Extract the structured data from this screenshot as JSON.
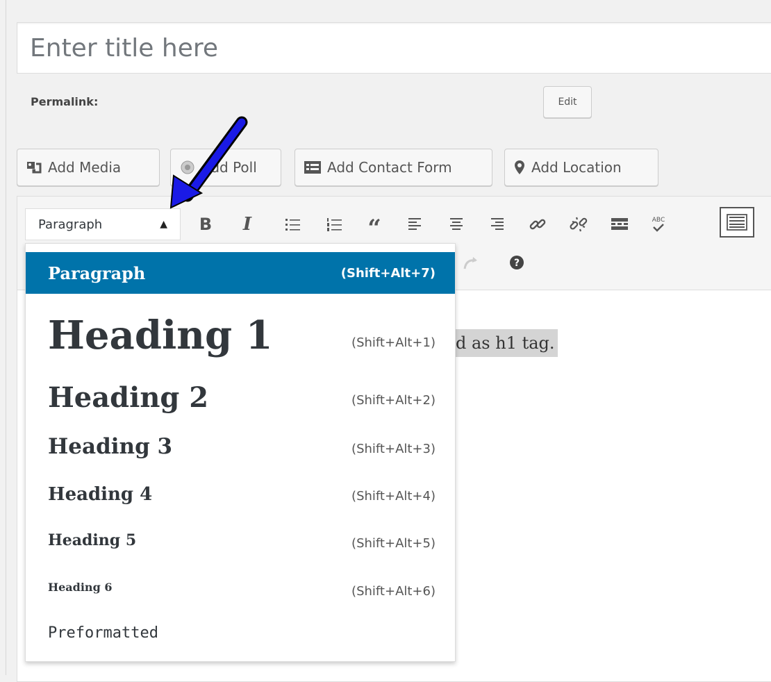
{
  "title_field": {
    "placeholder": "Enter title here"
  },
  "permalink": {
    "label": "Permalink:",
    "edit_label": "Edit"
  },
  "media_buttons": {
    "add_media": "Add Media",
    "add_poll": "Add Poll",
    "add_contact_form": "Add Contact Form",
    "add_location": "Add Location"
  },
  "toolbar": {
    "format_select_value": "Paragraph",
    "bold": "B",
    "italic": "I",
    "blockquote": "“",
    "spellcheck": "ABC"
  },
  "editor": {
    "content_visible": "d as h1 tag."
  },
  "format_dropdown": {
    "items": [
      {
        "label": "Paragraph",
        "shortcut": "(Shift+Alt+7)"
      },
      {
        "label": "Heading 1",
        "shortcut": "(Shift+Alt+1)"
      },
      {
        "label": "Heading 2",
        "shortcut": "(Shift+Alt+2)"
      },
      {
        "label": "Heading 3",
        "shortcut": "(Shift+Alt+3)"
      },
      {
        "label": "Heading 4",
        "shortcut": "(Shift+Alt+4)"
      },
      {
        "label": "Heading 5",
        "shortcut": "(Shift+Alt+5)"
      },
      {
        "label": "Heading 6",
        "shortcut": "(Shift+Alt+6)"
      },
      {
        "label": "Preformatted",
        "shortcut": ""
      }
    ],
    "selected_index": 0
  },
  "colors": {
    "accent": "#0073aa",
    "annotation_arrow": "#1a1ae6"
  }
}
